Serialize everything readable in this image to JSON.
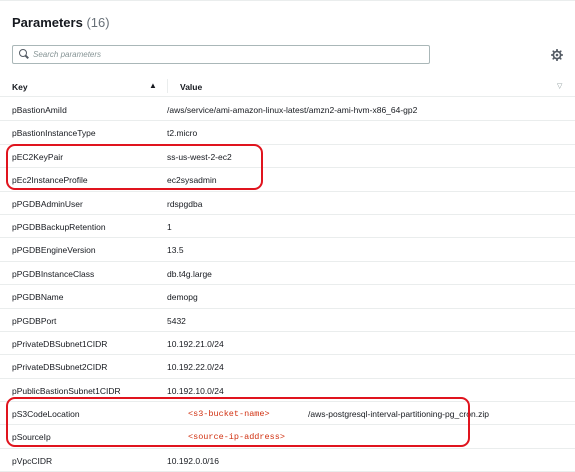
{
  "header": {
    "title": "Parameters",
    "count": "(16)"
  },
  "search": {
    "placeholder": "Search parameters"
  },
  "table": {
    "columns": {
      "key": "Key",
      "value": "Value"
    },
    "rows": [
      {
        "key": "pBastionAmiId",
        "value": "/aws/service/ami-amazon-linux-latest/amzn2-ami-hvm-x86_64-gp2"
      },
      {
        "key": "pBastionInstanceType",
        "value": "t2.micro"
      },
      {
        "key": "pEC2KeyPair",
        "value": "ss-us-west-2-ec2"
      },
      {
        "key": "pEc2InstanceProfile",
        "value": "ec2sysadmin"
      },
      {
        "key": "pPGDBAdminUser",
        "value": "rdspgdba"
      },
      {
        "key": "pPGDBBackupRetention",
        "value": "1"
      },
      {
        "key": "pPGDBEngineVersion",
        "value": "13.5"
      },
      {
        "key": "pPGDBInstanceClass",
        "value": "db.t4g.large"
      },
      {
        "key": "pPGDBName",
        "value": "demopg"
      },
      {
        "key": "pPGDBPort",
        "value": "5432"
      },
      {
        "key": "pPrivateDBSubnet1CIDR",
        "value": "10.192.21.0/24"
      },
      {
        "key": "pPrivateDBSubnet2CIDR",
        "value": "10.192.22.0/24"
      },
      {
        "key": "pPublicBastionSubnet1CIDR",
        "value": "10.192.10.0/24"
      },
      {
        "key": "pS3CodeLocation",
        "placeholder": "<s3-bucket-name>",
        "value_suffix": "/aws-postgresql-interval-partitioning-pg_cron.zip"
      },
      {
        "key": "pSourceIp",
        "placeholder": "<source-ip-address>"
      },
      {
        "key": "pVpcCIDR",
        "value": "10.192.0.0/16"
      }
    ]
  },
  "icons": {
    "search": "search-icon",
    "settings": "gear-icon",
    "sort": "sort-ascending-icon",
    "filter": "filter-caret-icon"
  },
  "colors": {
    "highlight": "#e0141e",
    "placeholder_text": "#d13212"
  }
}
